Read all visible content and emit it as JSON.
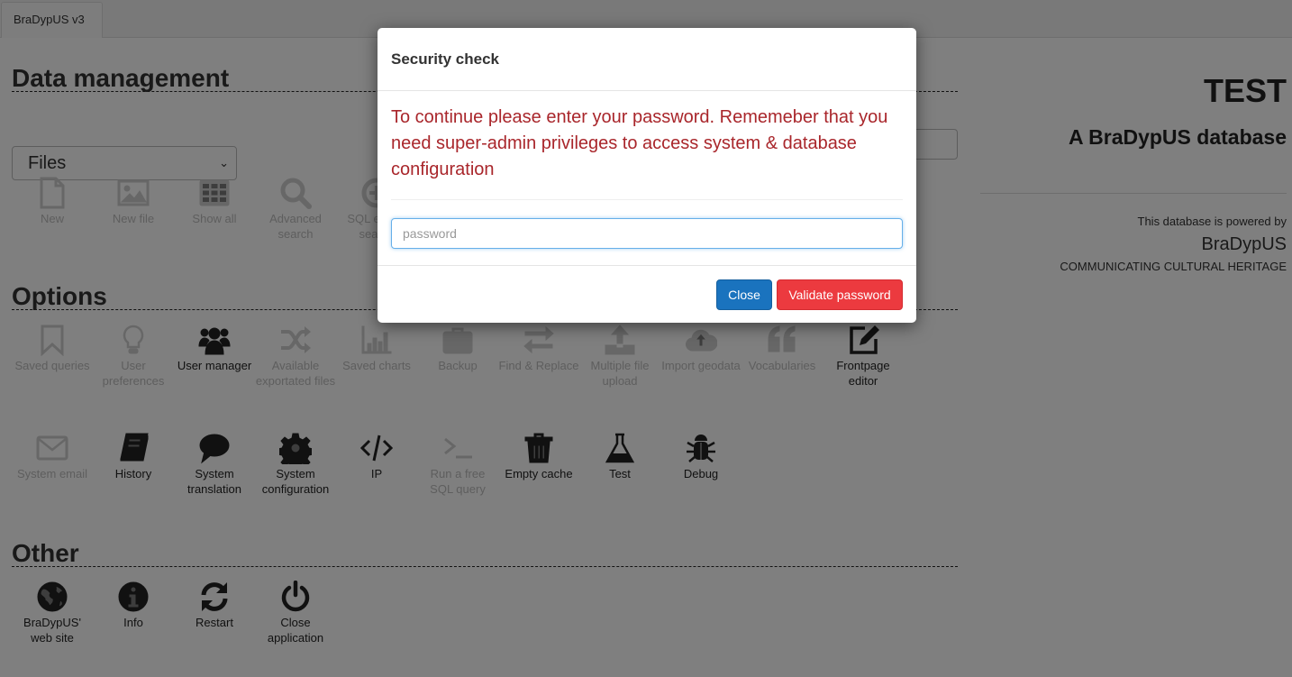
{
  "tab": {
    "label": "BraDypUS v3"
  },
  "sections": {
    "data_management": {
      "title": "Data management",
      "table_select": {
        "value": "Files"
      },
      "items": [
        {
          "label": "New",
          "icon": "file-icon",
          "enabled": false
        },
        {
          "label": "New file",
          "icon": "image-icon",
          "enabled": false
        },
        {
          "label": "Show all",
          "icon": "table-icon",
          "enabled": false
        },
        {
          "label": "Advanced search",
          "icon": "search-icon",
          "enabled": false
        },
        {
          "label": "SQL expert search",
          "icon": "plus-circle-icon",
          "enabled": false
        }
      ]
    },
    "options": {
      "title": "Options",
      "items_row1": [
        {
          "label": "Saved queries",
          "icon": "bookmark-icon",
          "enabled": false
        },
        {
          "label": "User preferences",
          "icon": "lightbulb-icon",
          "enabled": false
        },
        {
          "label": "User manager",
          "icon": "users-icon",
          "enabled": true
        },
        {
          "label": "Available exportated files",
          "icon": "shuffle-icon",
          "enabled": false
        },
        {
          "label": "Saved charts",
          "icon": "bar-chart-icon",
          "enabled": false
        },
        {
          "label": "Backup",
          "icon": "briefcase-icon",
          "enabled": false
        },
        {
          "label": "Find & Replace",
          "icon": "exchange-icon",
          "enabled": false
        },
        {
          "label": "Multiple file upload",
          "icon": "upload-icon",
          "enabled": false
        },
        {
          "label": "Import geodata",
          "icon": "cloud-upload-icon",
          "enabled": false
        },
        {
          "label": "Vocabularies",
          "icon": "quote-icon",
          "enabled": false
        },
        {
          "label": "Frontpage editor",
          "icon": "edit-icon",
          "enabled": true
        }
      ],
      "items_row2": [
        {
          "label": "System email",
          "icon": "envelope-icon",
          "enabled": false
        },
        {
          "label": "History",
          "icon": "book-icon",
          "enabled": true
        },
        {
          "label": "System translation",
          "icon": "comment-icon",
          "enabled": true
        },
        {
          "label": "System configuration",
          "icon": "gear-icon",
          "enabled": true
        },
        {
          "label": "IP",
          "icon": "code-icon",
          "enabled": true
        },
        {
          "label": "Run a free SQL query",
          "icon": "terminal-icon",
          "enabled": false
        },
        {
          "label": "Empty cache",
          "icon": "trash-icon",
          "enabled": true
        },
        {
          "label": "Test",
          "icon": "flask-icon",
          "enabled": true
        },
        {
          "label": "Debug",
          "icon": "bug-icon",
          "enabled": true
        }
      ]
    },
    "other": {
      "title": "Other",
      "items": [
        {
          "label": "BraDypUS' web site",
          "icon": "globe-icon",
          "enabled": true
        },
        {
          "label": "Info",
          "icon": "info-icon",
          "enabled": true
        },
        {
          "label": "Restart",
          "icon": "refresh-icon",
          "enabled": true
        },
        {
          "label": "Close application",
          "icon": "power-icon",
          "enabled": true
        }
      ]
    }
  },
  "side": {
    "db_title": "TEST",
    "db_subtitle": "A BraDypUS database",
    "powered_by": "This database is powered by",
    "brand": "BraDypUS",
    "tagline": "COMMUNICATING CULTURAL HERITAGE"
  },
  "modal": {
    "title": "Security check",
    "message": "To continue please enter your password. Rememeber that you need super-admin privileges to access system & database configuration",
    "password_placeholder": "password",
    "password_value": "",
    "close_label": "Close",
    "validate_label": "Validate password",
    "colors": {
      "message": "#a9262b",
      "close_button": "#1a73be",
      "validate_button": "#ec3a3f"
    }
  }
}
